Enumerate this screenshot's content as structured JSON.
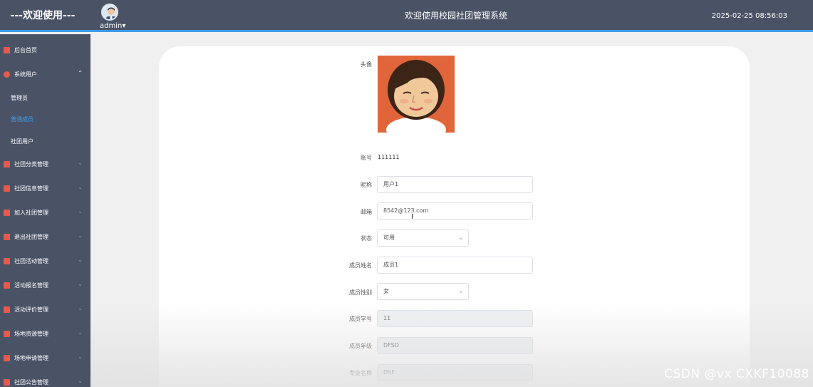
{
  "header": {
    "welcome": "---欢迎使用---",
    "username": "admin",
    "title": "欢迎使用校园社团管理系统",
    "datetime": "2025-02-25 08:56:03"
  },
  "sidebar": {
    "items": [
      {
        "label": "后台首页",
        "icon": "monitor-icon"
      },
      {
        "label": "系统用户",
        "icon": "user-icon"
      },
      {
        "label": "管理员"
      },
      {
        "label": "普通成员"
      },
      {
        "label": "社团用户"
      },
      {
        "label": "社团分类管理",
        "icon": "chart-icon"
      },
      {
        "label": "社团信息管理",
        "icon": "chart-icon"
      },
      {
        "label": "加入社团管理",
        "icon": "chart-icon"
      },
      {
        "label": "退出社团管理",
        "icon": "chart-icon"
      },
      {
        "label": "社团活动管理",
        "icon": "chart-icon"
      },
      {
        "label": "活动报名管理",
        "icon": "chart-icon"
      },
      {
        "label": "活动评价管理",
        "icon": "chart-icon"
      },
      {
        "label": "场地资源管理",
        "icon": "chart-icon"
      },
      {
        "label": "场地申请管理",
        "icon": "chart-icon"
      },
      {
        "label": "社团公告管理",
        "icon": "chart-icon"
      }
    ]
  },
  "form": {
    "avatar_label": "头像",
    "account_label": "账号",
    "account_value": "111111",
    "nickname_label": "昵称",
    "nickname_value": "用户1",
    "email_label": "邮箱",
    "email_value": "8542@123.com",
    "status_label": "状态",
    "status_value": "可用",
    "name_label": "成员姓名",
    "name_value": "成员1",
    "gender_label": "成员性别",
    "gender_value": "女",
    "student_id_label": "成员学号",
    "student_id_value": "11",
    "grade_label": "成员年级",
    "grade_value": "DFSD",
    "major_label": "专业名称",
    "major_value": "DSF"
  },
  "watermark": "CSDN @vx  CXKF10088"
}
